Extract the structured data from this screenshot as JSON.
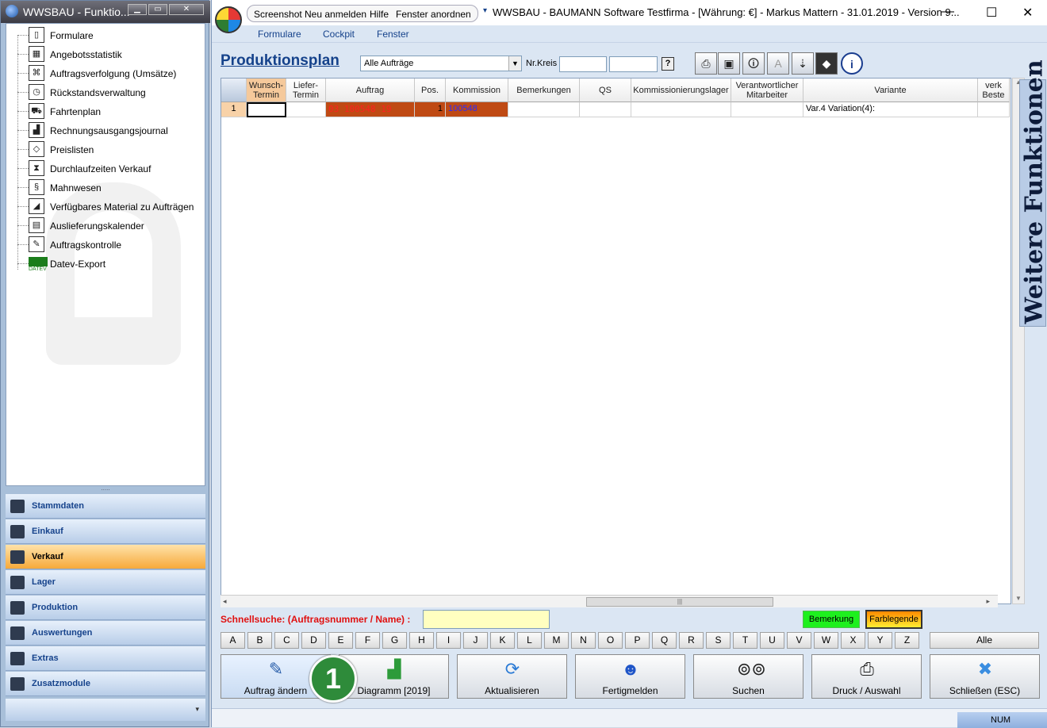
{
  "side_window": {
    "title": "WWSBAU - Funktio...",
    "controls": [
      "minimize-icon",
      "restore-icon",
      "close-icon"
    ],
    "tree": [
      {
        "label": "Formulare",
        "icon": "document-icon"
      },
      {
        "label": "Angebotsstatistik",
        "icon": "calendar-chart-icon"
      },
      {
        "label": "Auftragsverfolgung (Umsätze)",
        "icon": "tracking-icon"
      },
      {
        "label": "Rückstandsverwaltung",
        "icon": "clock-icon"
      },
      {
        "label": "Fahrtenplan",
        "icon": "truck-icon"
      },
      {
        "label": "Rechnungsausgangsjournal",
        "icon": "journal-icon"
      },
      {
        "label": "Preislisten",
        "icon": "price-tag-icon"
      },
      {
        "label": "Durchlaufzeiten Verkauf",
        "icon": "hourglass-icon"
      },
      {
        "label": "Mahnwesen",
        "icon": "dunning-icon"
      },
      {
        "label": "Verfügbares Material zu Aufträgen",
        "icon": "material-icon"
      },
      {
        "label": "Auslieferungskalender",
        "icon": "calendar-icon"
      },
      {
        "label": "Auftragskontrolle",
        "icon": "checklist-icon"
      },
      {
        "label": "Datev-Export",
        "icon": "datev-icon",
        "icon_text": "DATEV"
      }
    ],
    "nav": [
      {
        "label": "Stammdaten",
        "active": false
      },
      {
        "label": "Einkauf",
        "active": false
      },
      {
        "label": "Verkauf",
        "active": true
      },
      {
        "label": "Lager",
        "active": false
      },
      {
        "label": "Produktion",
        "active": false
      },
      {
        "label": "Auswertungen",
        "active": false
      },
      {
        "label": "Extras",
        "active": false
      },
      {
        "label": "Zusatzmodule",
        "active": false
      }
    ]
  },
  "main_window": {
    "quick_access": [
      "Screenshot",
      "Neu anmelden",
      "Hilfe",
      "Fenster anordnen"
    ],
    "title": "WWSBAU - BAUMANN Software Testfirma - [Währung: €] -   Markus Mattern - 31.01.2019 - Version 9...",
    "menu": [
      "Formulare",
      "Cockpit",
      "Fenster"
    ]
  },
  "page": {
    "heading": "Produktionsplan",
    "filter_value": "Alle Aufträge",
    "nr_kreis_label": "Nr.Kreis",
    "help_label": "?",
    "toolbar_icons": [
      "printer-icon",
      "screen-icon",
      "info-document-icon",
      "font-icon",
      "sort-icon",
      "expand-collapse-icon",
      "info-icon"
    ]
  },
  "grid": {
    "columns": [
      "",
      "Wunsch-\nTermin",
      "Liefer-\nTermin",
      "Auftrag",
      "Pos.",
      "Kommission",
      "Bemerkungen",
      "QS",
      "Kommissionierungslager",
      "Verantwortlicher\nMitarbeiter",
      "Variante",
      "verk\nBeste"
    ],
    "rows": [
      [
        "1",
        "",
        "",
        "03 100548 19",
        "1",
        "100548",
        "",
        "",
        "",
        "",
        "Var.4 Variation(4):",
        ""
      ]
    ],
    "side_tab": "Weitere Funktionen"
  },
  "quicksearch": {
    "label": "Schnellsuche: (Auftragsnummer / Name) :",
    "value": "",
    "bemerkung_label": "Bemerkung",
    "farblegende_label": "Farblegende"
  },
  "alphabet": [
    "A",
    "B",
    "C",
    "D",
    "E",
    "F",
    "G",
    "H",
    "I",
    "J",
    "K",
    "L",
    "M",
    "N",
    "O",
    "P",
    "Q",
    "R",
    "S",
    "T",
    "U",
    "V",
    "W",
    "X",
    "Y",
    "Z"
  ],
  "alle_label": "Alle",
  "actions": [
    {
      "label": "Auftrag ändern",
      "icon": "edit-icon"
    },
    {
      "label": "Diagramm [2019]",
      "icon": "chart-icon"
    },
    {
      "label": "Aktualisieren",
      "icon": "refresh-icon"
    },
    {
      "label": "Fertigmelden",
      "icon": "user-check-icon"
    },
    {
      "label": "Suchen",
      "icon": "binoculars-icon"
    },
    {
      "label": "Druck / Auswahl",
      "icon": "printer-icon"
    },
    {
      "label": "Schließen (ESC)",
      "icon": "close-icon"
    }
  ],
  "badge": "1",
  "status": {
    "num_label": "NUM"
  },
  "colors": {
    "accent": "#15428b",
    "row_highlight": "#bf4a14",
    "auftrag_text": "#ff2020",
    "quicksearch_label": "#e01010",
    "search_field": "#ffffc0",
    "bemerkung": "#1ef01e",
    "badge": "#2e8b3a"
  }
}
